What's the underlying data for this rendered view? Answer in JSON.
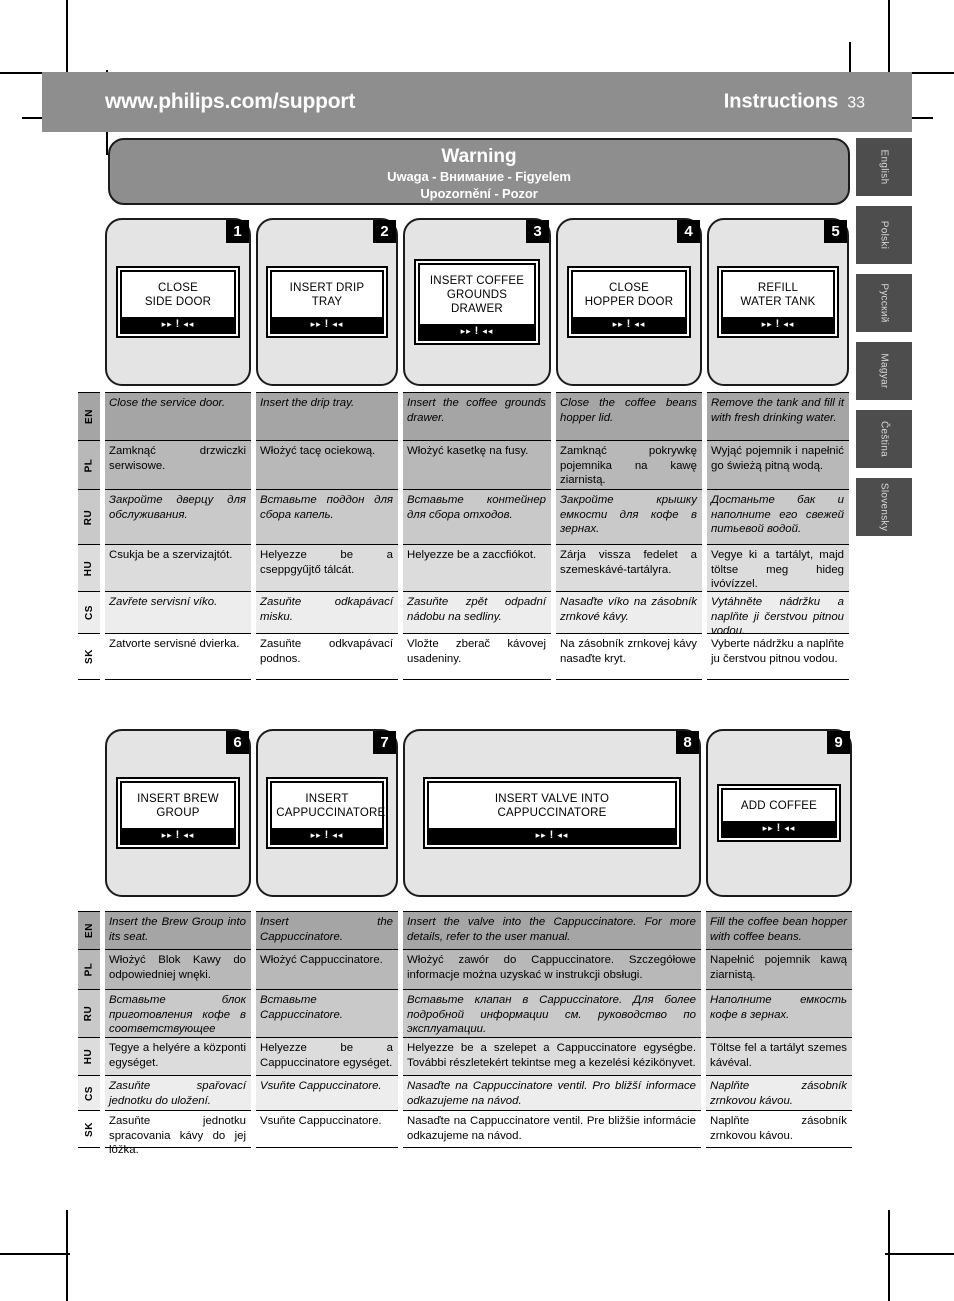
{
  "header": {
    "url": "www.philips.com/support",
    "section": "Instructions",
    "page_number": "33"
  },
  "language_tabs": [
    {
      "label": "English"
    },
    {
      "label": "Polski"
    },
    {
      "label": "Русский"
    },
    {
      "label": "Magyar"
    },
    {
      "label": "Čeština"
    },
    {
      "label": "Slovensky"
    }
  ],
  "warning": {
    "title": "Warning",
    "subtitle_line1": "Uwaga - Внимание - Figyelem",
    "subtitle_line2": "Upozornění - Pozor"
  },
  "lcd_bar_glyphs": {
    "left": "▸▸",
    "middle": "!",
    "right": "◂◂"
  },
  "language_codes": [
    "EN",
    "PL",
    "RU",
    "HU",
    "CS",
    "SK"
  ],
  "panel_row_1": [
    {
      "number": "1",
      "display": "CLOSE\nSIDE DOOR"
    },
    {
      "number": "2",
      "display": "INSERT DRIP TRAY"
    },
    {
      "number": "3",
      "display": "INSERT COFFEE\nGROUNDS DRAWER"
    },
    {
      "number": "4",
      "display": "CLOSE\nHOPPER DOOR"
    },
    {
      "number": "5",
      "display": "REFILL\nWATER TANK"
    }
  ],
  "panel_row_2": [
    {
      "number": "6",
      "display": "INSERT BREW GROUP"
    },
    {
      "number": "7",
      "display": "INSERT\nCAPPUCCINATORE"
    },
    {
      "number": "8",
      "display": "INSERT VALVE INTO\nCAPPUCCINATORE"
    },
    {
      "number": "9",
      "display": "ADD COFFEE"
    }
  ],
  "table_1": {
    "columns": [
      {
        "EN": "Close the service door.",
        "PL": "Zamknąć drzwiczki serwisowe.",
        "RU": "Закройте дверцу для обслуживания.",
        "HU": "Csukja be a szervizajtót.",
        "CS": "Zavřete servisní víko.",
        "SK": "Zatvorte servisné dvierka."
      },
      {
        "EN": "Insert the drip tray.",
        "PL": "Włożyć tacę ociekową.",
        "RU": "Вставьте поддон для сбора капель.",
        "HU": "Helyezze be a cseppgyűjtő tálcát.",
        "CS": "Zasuňte odkapávací misku.",
        "SK": "Zasuňte odkvapávací podnos."
      },
      {
        "EN": "Insert the coffee grounds drawer.",
        "PL": "Włożyć kasetkę na fusy.",
        "RU": "Вставьте контейнер для сбора отходов.",
        "HU": "Helyezze be a zaccfiókot.",
        "CS": "Zasuňte zpět odpadní nádobu na sedliny.",
        "SK": "Vložte zberač kávovej usadeniny."
      },
      {
        "EN": "Close the coffee beans hopper lid.",
        "PL": "Zamknąć pokrywkę pojemnika na kawę ziarnistą.",
        "RU": "Закройте крышку емкости для кофе в зернах.",
        "HU": "Zárja vissza fedelet a szemeskávé-tartályra.",
        "CS": "Nasaďte víko na zásobník zrnkové kávy.",
        "SK": "Na zásobník zrnkovej kávy nasaďte kryt."
      },
      {
        "EN": "Remove the tank and fill it with fresh drinking water.",
        "PL": "Wyjąć pojemnik i napełnić go świeżą pitną wodą.",
        "RU": "Достаньте бак и наполните его свежей питьевой водой.",
        "HU": "Vegye ki a tartályt, majd töltse meg hideg ivóvízzel.",
        "CS": "Vytáhněte nádržku a naplňte ji čerstvou pitnou vodou.",
        "SK": "Vyberte nádržku a naplňte ju čerstvou pitnou vodou."
      }
    ]
  },
  "table_2": {
    "columns": [
      {
        "EN": "Insert the Brew Group into its seat.",
        "PL": "Włożyć Blok Kawy do odpowiedniej wnęki.",
        "RU": "Вставьте блок приготовления кофе в соответствующее гнездо.",
        "HU": "Tegye a helyére a központi egységet.",
        "CS": "Zasuňte spařovací jednotku do uložení.",
        "SK": "Zasuňte jednotku spracovania kávy do jej lôžka."
      },
      {
        "EN": "Insert the Cappuccinatore.",
        "PL": "Włożyć Cappuccinatore.",
        "RU": "Вставьте Cappuccinatore.",
        "HU": "Helyezze be a Cappuccinatore egységet.",
        "CS": "Vsuňte Cappuccinatore.",
        "SK": "Vsuňte Cappuccinatore."
      },
      {
        "EN": "Insert the valve into the Cappuccinatore. For more details, refer to the user manual.",
        "PL": "Włożyć zawór do Cappuccinatore. Szczegółowe informacje można uzyskać w instrukcji obsługi.",
        "RU": "Вставьте клапан в Cappuccinatore. Для более подробной информации см. руководство по эксплуатации.",
        "HU": "Helyezze be a szelepet a Cappuccinatore egységbe. További részletekért tekintse meg a kezelési kézikönyvet.",
        "CS": "Nasaďte na Cappuccinatore ventil. Pro bližší informace odkazujeme na návod.",
        "SK": "Nasaďte na Cappuccinatore ventil. Pre bližšie informácie odkazujeme na návod."
      },
      {
        "EN": "Fill the coffee bean hopper with coffee beans.",
        "PL": "Napełnić pojemnik kawą ziarnistą.",
        "RU": "Наполните емкость кофе в зернах.",
        "HU": "Töltse fel a tartályt szemes kávéval.",
        "CS": "Naplňte zásobník zrnkovou kávou.",
        "SK": "Naplňte zásobník zrnkovou kávou."
      }
    ]
  }
}
